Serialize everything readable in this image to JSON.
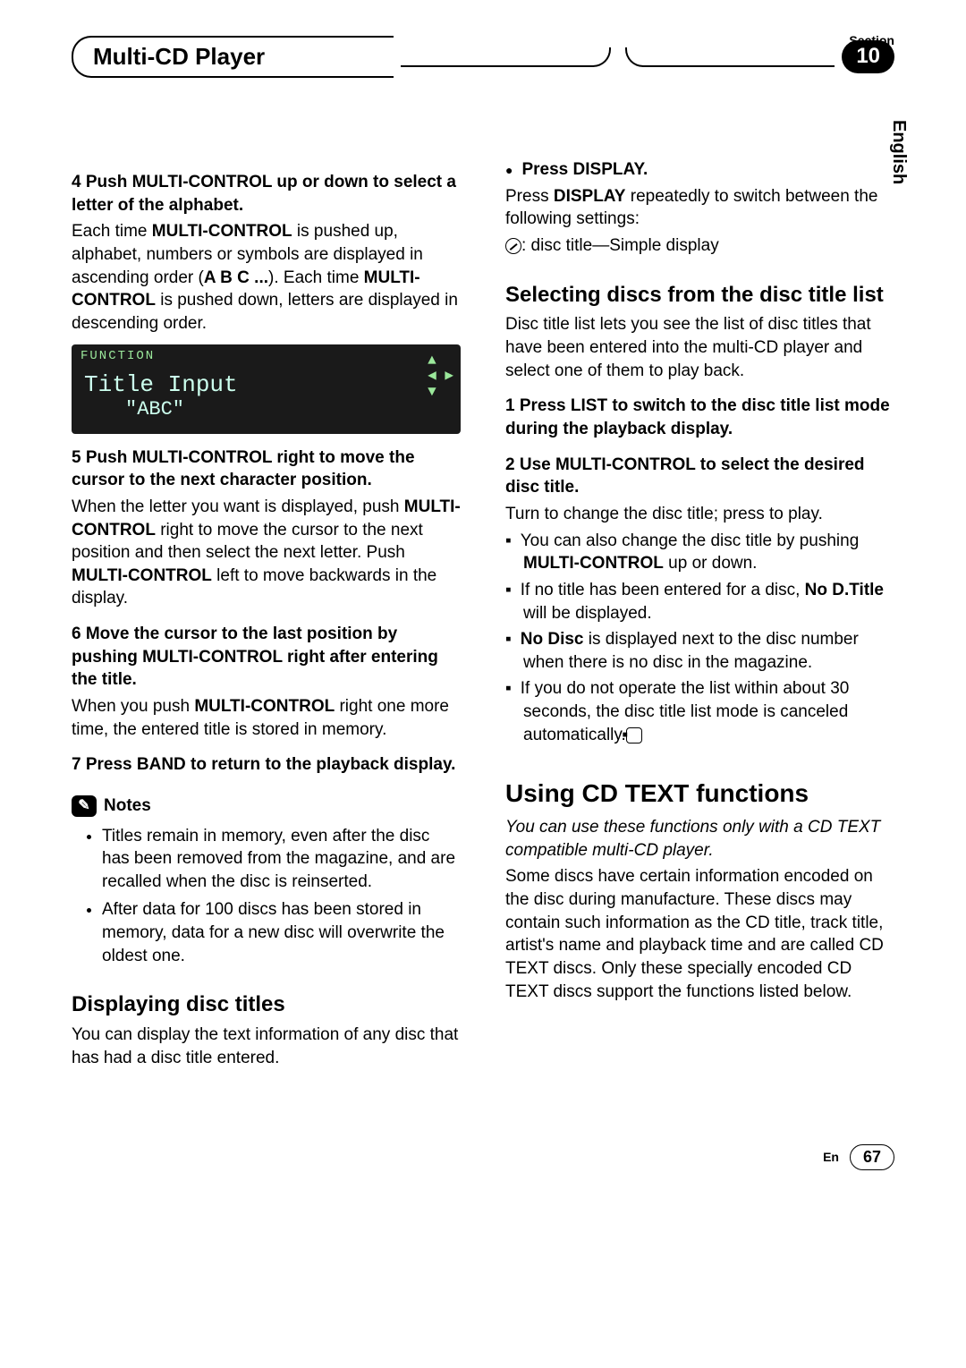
{
  "header": {
    "section_label": "Section",
    "section_number": "10",
    "title": "Multi-CD Player",
    "language": "English"
  },
  "left": {
    "step4": {
      "head": "4   Push MULTI-CONTROL up or down to select a letter of the alphabet.",
      "body1": "Each time ",
      "mc1": "MULTI-CONTROL",
      "body2": " is pushed up, alphabet, numbers or symbols are displayed in ascending order (",
      "abc": "A B C ...",
      "body3": "). Each time ",
      "mc2": "MULTI-CONTROL",
      "body4": " is pushed down, letters are displayed in descending order."
    },
    "display": {
      "func": "FUNCTION",
      "title": "Title Input",
      "abc": "\"ABC\""
    },
    "step5": {
      "head": "5   Push MULTI-CONTROL right to move the cursor to the next character position.",
      "body1": "When the letter you want is displayed, push ",
      "mc1": "MULTI-CONTROL",
      "body2": " right to move the cursor to the next position and then select the next letter. Push ",
      "mc2": "MULTI-CONTROL",
      "body3": " left to move backwards in the display."
    },
    "step6": {
      "head": "6   Move the cursor to the last position by pushing MULTI-CONTROL right after entering the title.",
      "body1": "When you push ",
      "mc": "MULTI-CONTROL",
      "body2": " right one more time, the entered title is stored in memory."
    },
    "step7": {
      "head": "7   Press BAND to return to the playback display."
    },
    "notes_label": "Notes",
    "notes": [
      "Titles remain in memory, even after the disc has been removed from the magazine, and are recalled when the disc is reinserted.",
      "After data for 100 discs has been stored in memory, data for a new disc will overwrite the oldest one."
    ],
    "disp_titles_head": "Displaying disc titles",
    "disp_titles_body": "You can display the text information of any disc that has had a disc title entered."
  },
  "right": {
    "press_display_head": "Press DISPLAY.",
    "press_display_b1": "Press ",
    "press_display_bold": "DISPLAY",
    "press_display_b2": " repeatedly to switch between the following settings:",
    "press_display_line": ": disc title—Simple display",
    "sel_head": "Selecting discs from the disc title list",
    "sel_body": "Disc title list lets you see the list of disc titles that have been entered into the multi-CD player and select one of them to play back.",
    "sel_step1": "1   Press LIST to switch to the disc title list mode during the playback display.",
    "sel_step2": "2   Use MULTI-CONTROL to select the desired disc title.",
    "sel_turn": "Turn to change the disc title; press to play.",
    "sq1a": "You can also change the disc title by pushing ",
    "sq1b": "MULTI-CONTROL",
    "sq1c": " up or down.",
    "sq2a": "If no title has been entered for a disc, ",
    "sq2b": "No D.Title",
    "sq2c": " will be displayed.",
    "sq3a": "No Disc",
    "sq3b": " is displayed next to the disc number when there is no disc in the magazine.",
    "sq4": "If you do not operate the list within about 30 seconds, the disc title list mode is canceled automatically.",
    "cdtext_head": "Using CD TEXT functions",
    "cdtext_ital": "You can use these functions only with a CD TEXT compatible multi-CD player.",
    "cdtext_body": "Some discs have certain information encoded on the disc during manufacture. These discs may contain such information as the CD title, track title, artist's name and playback time and are called CD TEXT discs. Only these specially encoded CD TEXT discs support the functions listed below."
  },
  "footer": {
    "lang": "En",
    "page": "67"
  }
}
